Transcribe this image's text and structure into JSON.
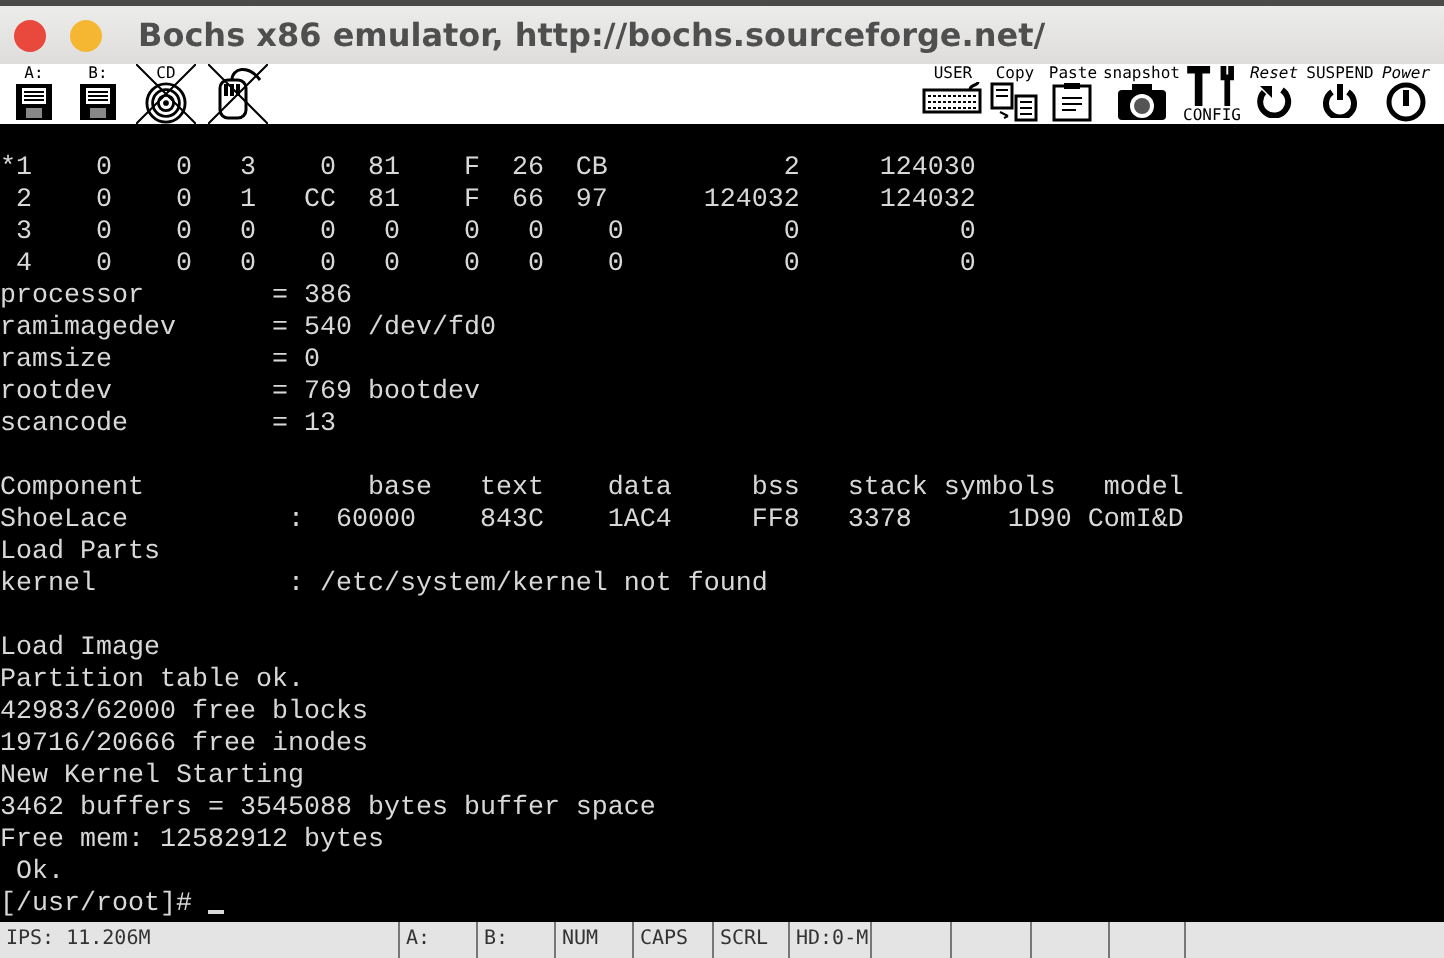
{
  "window": {
    "title": "Bochs x86 emulator, http://bochs.sourceforge.net/"
  },
  "toolbar": {
    "left": [
      {
        "kind": "floppy",
        "label": "A:",
        "crossed": false
      },
      {
        "kind": "floppy",
        "label": "B:",
        "crossed": false
      },
      {
        "kind": "cdrom",
        "label": "CD",
        "crossed": true
      },
      {
        "kind": "mouse",
        "crossed": true
      }
    ],
    "right": [
      {
        "kind": "keyboard",
        "label": "USER"
      },
      {
        "kind": "copy",
        "label": "Copy"
      },
      {
        "kind": "paste",
        "label": "Paste"
      },
      {
        "kind": "snapshot",
        "label": "snapshot"
      },
      {
        "kind": "config",
        "label": "CONFIG"
      },
      {
        "kind": "reset",
        "label": "Reset"
      },
      {
        "kind": "suspend",
        "label": "SUSPEND"
      },
      {
        "kind": "power",
        "label": "Power"
      }
    ]
  },
  "console": {
    "blocks": [
      [
        "*1    0    0   3    0  81    F  26  CB           2     124030",
        " 2    0    0   1   CC  81    F  66  97      124032     124032",
        " 3    0    0   0    0   0    0   0    0          0          0",
        " 4    0    0   0    0   0    0   0    0          0          0",
        "processor        = 386",
        "ramimagedev      = 540 /dev/fd0",
        "ramsize          = 0",
        "rootdev          = 769 bootdev",
        "scancode         = 13"
      ],
      [
        "Component              base   text    data     bss   stack symbols   model",
        "ShoeLace          :  60000    843C    1AC4     FF8   3378      1D90 ComI&D",
        "Load Parts",
        "kernel            : /etc/system/kernel not found"
      ],
      [
        "Load Image",
        "Partition table ok.",
        "42983/62000 free blocks",
        "19716/20666 free inodes",
        "New Kernel Starting",
        "3462 buffers = 3545088 bytes buffer space",
        "Free mem: 12582912 bytes",
        " Ok."
      ]
    ],
    "prompt": "[/usr/root]# "
  },
  "status_bar": [
    "IPS: 11.206M",
    "A:",
    "B:",
    "NUM",
    "CAPS",
    "SCRL",
    "HD:0-M"
  ]
}
